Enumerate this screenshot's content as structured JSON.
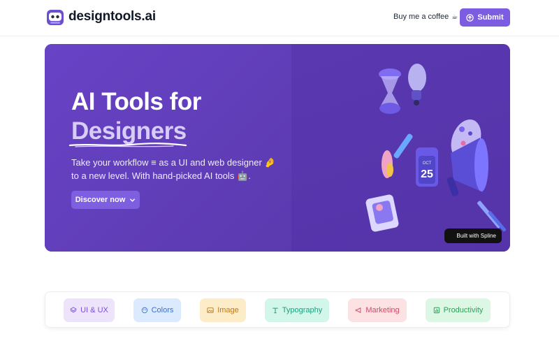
{
  "header": {
    "brand": "designtools.ai",
    "coffee_label": "Buy me a coffee",
    "coffee_emoji": "☕",
    "submit_label": "Submit"
  },
  "hero": {
    "title_line1": "AI Tools for",
    "title_line2": "Designers",
    "description": "Take your workflow ≡ as a UI and web designer 🤌 to a new level. With hand-picked AI tools 🤖.",
    "discover_label": "Discover now",
    "spline_badge": "Built with Spline",
    "calendar": {
      "month": "OCT",
      "day": "25"
    }
  },
  "categories": [
    {
      "label": "UI & UX",
      "icon": "layers-icon",
      "bg": "#ede4fb",
      "fg": "#7a4fd6"
    },
    {
      "label": "Colors",
      "icon": "palette-icon",
      "bg": "#dbeafe",
      "fg": "#3b6fd1"
    },
    {
      "label": "Image",
      "icon": "image-icon",
      "bg": "#fdecc8",
      "fg": "#b7791f"
    },
    {
      "label": "Typography",
      "icon": "type-icon",
      "bg": "#d3f6ea",
      "fg": "#1f9d7a"
    },
    {
      "label": "Marketing",
      "icon": "megaphone-icon",
      "bg": "#fde2e4",
      "fg": "#d04766"
    },
    {
      "label": "Productivity",
      "icon": "chart-icon",
      "bg": "#dcf7e4",
      "fg": "#2f9e57"
    }
  ],
  "colors": {
    "accent": "#7c5ce0",
    "hero_bg": "#5a3ab4"
  }
}
